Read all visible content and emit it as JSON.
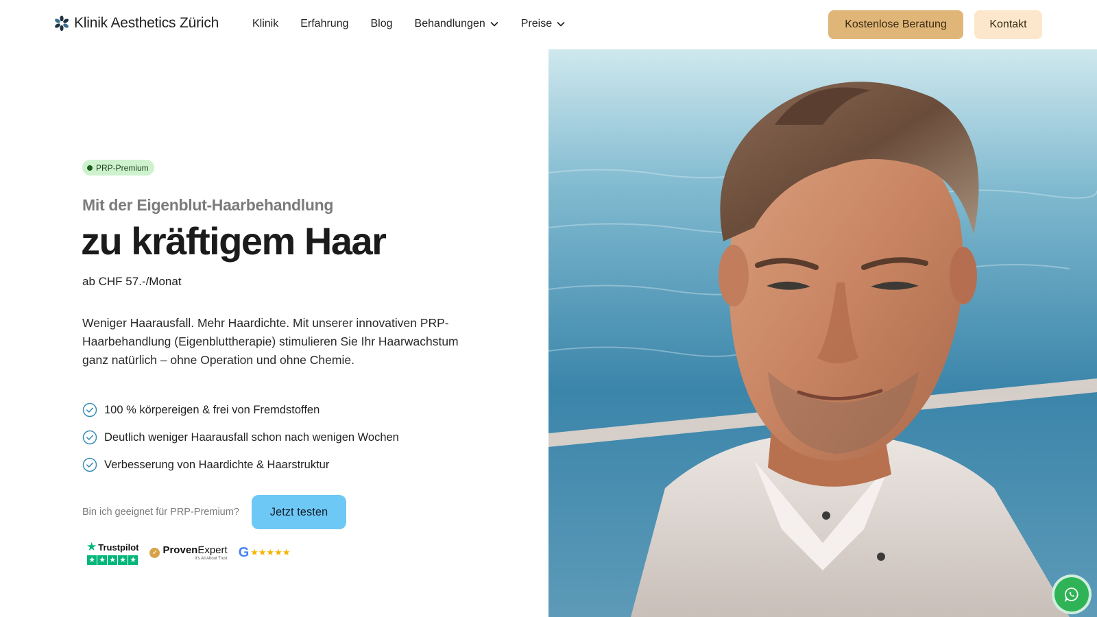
{
  "header": {
    "brand": "Klinik Aesthetics Zürich",
    "nav": [
      {
        "label": "Klinik",
        "dropdown": false
      },
      {
        "label": "Erfahrung",
        "dropdown": false
      },
      {
        "label": "Blog",
        "dropdown": false
      },
      {
        "label": "Behandlungen",
        "dropdown": true
      },
      {
        "label": "Preise",
        "dropdown": true
      }
    ],
    "cta_primary": "Kostenlose Beratung",
    "cta_secondary": "Kontakt"
  },
  "hero": {
    "badge": "PRP-Premium",
    "subheadline": "Mit der Eigenblut-Haarbehandlung",
    "headline": "zu kräftigem Haar",
    "price": "ab CHF 57.-/Monat",
    "description": "Weniger Haarausfall. Mehr Haardichte. Mit unserer innovativen PRP-Haarbehandlung (Eigenbluttherapie) stimulieren Sie Ihr Haarwachstum ganz natürlich – ohne Operation und ohne Chemie.",
    "benefits": [
      "100 % körpereigen & frei von Fremdstoffen",
      "Deutlich weniger Haarausfall schon nach wenigen Wochen",
      "Verbesserung von Haardichte & Haarstruktur"
    ],
    "cta_question": "Bin ich geeignet für PRP-Premium?",
    "cta_button": "Jetzt testen"
  },
  "trust": {
    "trustpilot": "Trustpilot",
    "proven_expert_bold": "Proven",
    "proven_expert_rest": "Expert",
    "proven_expert_tagline": "It's All About Trust",
    "google": "G",
    "google_stars": "★★★★★",
    "trustpilot_stars": 5
  },
  "colors": {
    "cta_primary": "#e0b678",
    "cta_secondary": "#fce7cc",
    "test_button": "#6ec8f5",
    "badge": "#cdf2cd",
    "check": "#3a8fb5",
    "whatsapp": "#30b356"
  },
  "icons": {
    "logo": "asterisk-flower-icon",
    "dropdown": "chevron-down-icon",
    "benefit": "check-circle-icon",
    "chat": "whatsapp-icon"
  }
}
